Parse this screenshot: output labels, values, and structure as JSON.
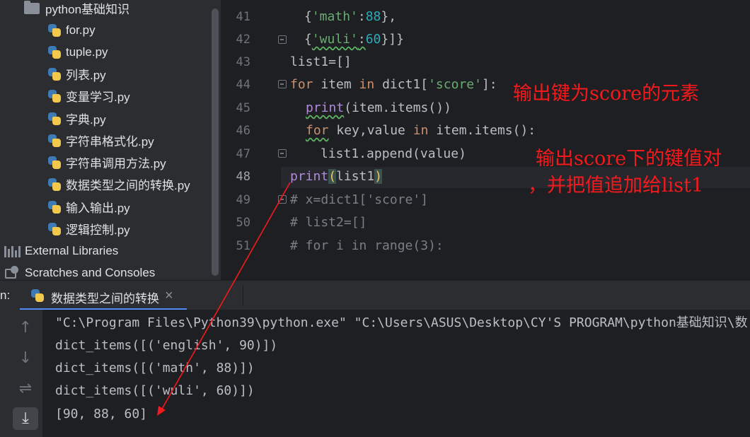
{
  "project_tree": {
    "folder": "python基础知识",
    "files": [
      "for.py",
      "tuple.py",
      "列表.py",
      "变量学习.py",
      "字典.py",
      "字符串格式化.py",
      "字符串调用方法.py",
      "数据类型之间的转换.py",
      "输入输出.py",
      "逻辑控制.py"
    ],
    "external_libraries": "External Libraries",
    "scratches": "Scratches and Consoles"
  },
  "editor": {
    "line_numbers": [
      "41",
      "42",
      "43",
      "44",
      "45",
      "46",
      "47",
      "48",
      "49",
      "50",
      "51"
    ],
    "code": {
      "l41_a": "{",
      "l41_b": "'math'",
      "l41_c": ":",
      "l41_d": "88",
      "l41_e": "},",
      "l42_a": "{",
      "l42_b": "'wuli'",
      "l42_c": ":",
      "l42_d": "60",
      "l42_e": "}]}",
      "l43": "list1=[]",
      "l44_kw1": "for",
      "l44_a": " item ",
      "l44_kw2": "in",
      "l44_b": " dict1[",
      "l44_str": "'score'",
      "l44_c": "]:",
      "l45_fn": "print",
      "l45_a": "(item.items())",
      "l46_kw1": "for",
      "l46_a": " key,value ",
      "l46_kw2": "in",
      "l46_b": " item.items():",
      "l47": "list1.append(value)",
      "l48_fn": "print",
      "l48_b1": "(",
      "l48_a": "list1",
      "l48_b2": ")",
      "l49": "# x=dict1['score']",
      "l50": "# list2=[]",
      "l51": "# for i in range(3):"
    },
    "annotations": {
      "note1": "输出键为score的元素",
      "note2_line1": "输出score下的键值对",
      "note2_line2": "，并把值追加给list1"
    }
  },
  "run_panel": {
    "label": "n:",
    "tab": "数据类型之间的转换",
    "close": "×",
    "output": [
      "\"C:\\Program Files\\Python39\\python.exe\" \"C:\\Users\\ASUS\\Desktop\\CY'S PROGRAM\\python基础知识\\数",
      "dict_items([('english', 90)])",
      "dict_items([('math', 88)])",
      "dict_items([('wuli', 60)])",
      "[90, 88, 60]"
    ]
  },
  "colors": {
    "annotation": "#f4191c",
    "keyword": "#cf8e6d",
    "string": "#6aab73",
    "number": "#2aacb8"
  }
}
